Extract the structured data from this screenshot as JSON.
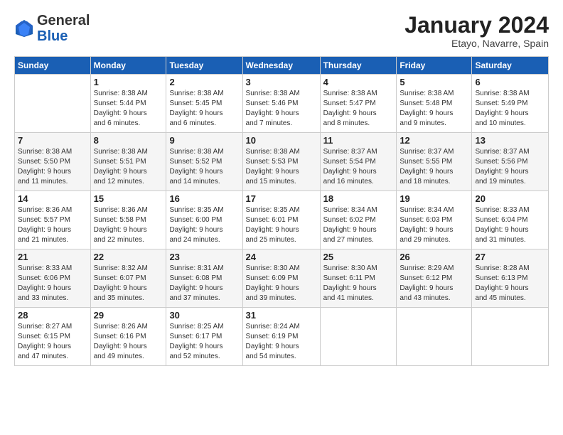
{
  "header": {
    "logo": {
      "general": "General",
      "blue": "Blue"
    },
    "title": "January 2024",
    "location": "Etayo, Navarre, Spain"
  },
  "columns": [
    "Sunday",
    "Monday",
    "Tuesday",
    "Wednesday",
    "Thursday",
    "Friday",
    "Saturday"
  ],
  "weeks": [
    [
      {
        "day": "",
        "detail": ""
      },
      {
        "day": "1",
        "detail": "Sunrise: 8:38 AM\nSunset: 5:44 PM\nDaylight: 9 hours\nand 6 minutes."
      },
      {
        "day": "2",
        "detail": "Sunrise: 8:38 AM\nSunset: 5:45 PM\nDaylight: 9 hours\nand 6 minutes."
      },
      {
        "day": "3",
        "detail": "Sunrise: 8:38 AM\nSunset: 5:46 PM\nDaylight: 9 hours\nand 7 minutes."
      },
      {
        "day": "4",
        "detail": "Sunrise: 8:38 AM\nSunset: 5:47 PM\nDaylight: 9 hours\nand 8 minutes."
      },
      {
        "day": "5",
        "detail": "Sunrise: 8:38 AM\nSunset: 5:48 PM\nDaylight: 9 hours\nand 9 minutes."
      },
      {
        "day": "6",
        "detail": "Sunrise: 8:38 AM\nSunset: 5:49 PM\nDaylight: 9 hours\nand 10 minutes."
      }
    ],
    [
      {
        "day": "7",
        "detail": "Sunrise: 8:38 AM\nSunset: 5:50 PM\nDaylight: 9 hours\nand 11 minutes."
      },
      {
        "day": "8",
        "detail": "Sunrise: 8:38 AM\nSunset: 5:51 PM\nDaylight: 9 hours\nand 12 minutes."
      },
      {
        "day": "9",
        "detail": "Sunrise: 8:38 AM\nSunset: 5:52 PM\nDaylight: 9 hours\nand 14 minutes."
      },
      {
        "day": "10",
        "detail": "Sunrise: 8:38 AM\nSunset: 5:53 PM\nDaylight: 9 hours\nand 15 minutes."
      },
      {
        "day": "11",
        "detail": "Sunrise: 8:37 AM\nSunset: 5:54 PM\nDaylight: 9 hours\nand 16 minutes."
      },
      {
        "day": "12",
        "detail": "Sunrise: 8:37 AM\nSunset: 5:55 PM\nDaylight: 9 hours\nand 18 minutes."
      },
      {
        "day": "13",
        "detail": "Sunrise: 8:37 AM\nSunset: 5:56 PM\nDaylight: 9 hours\nand 19 minutes."
      }
    ],
    [
      {
        "day": "14",
        "detail": "Sunrise: 8:36 AM\nSunset: 5:57 PM\nDaylight: 9 hours\nand 21 minutes."
      },
      {
        "day": "15",
        "detail": "Sunrise: 8:36 AM\nSunset: 5:58 PM\nDaylight: 9 hours\nand 22 minutes."
      },
      {
        "day": "16",
        "detail": "Sunrise: 8:35 AM\nSunset: 6:00 PM\nDaylight: 9 hours\nand 24 minutes."
      },
      {
        "day": "17",
        "detail": "Sunrise: 8:35 AM\nSunset: 6:01 PM\nDaylight: 9 hours\nand 25 minutes."
      },
      {
        "day": "18",
        "detail": "Sunrise: 8:34 AM\nSunset: 6:02 PM\nDaylight: 9 hours\nand 27 minutes."
      },
      {
        "day": "19",
        "detail": "Sunrise: 8:34 AM\nSunset: 6:03 PM\nDaylight: 9 hours\nand 29 minutes."
      },
      {
        "day": "20",
        "detail": "Sunrise: 8:33 AM\nSunset: 6:04 PM\nDaylight: 9 hours\nand 31 minutes."
      }
    ],
    [
      {
        "day": "21",
        "detail": "Sunrise: 8:33 AM\nSunset: 6:06 PM\nDaylight: 9 hours\nand 33 minutes."
      },
      {
        "day": "22",
        "detail": "Sunrise: 8:32 AM\nSunset: 6:07 PM\nDaylight: 9 hours\nand 35 minutes."
      },
      {
        "day": "23",
        "detail": "Sunrise: 8:31 AM\nSunset: 6:08 PM\nDaylight: 9 hours\nand 37 minutes."
      },
      {
        "day": "24",
        "detail": "Sunrise: 8:30 AM\nSunset: 6:09 PM\nDaylight: 9 hours\nand 39 minutes."
      },
      {
        "day": "25",
        "detail": "Sunrise: 8:30 AM\nSunset: 6:11 PM\nDaylight: 9 hours\nand 41 minutes."
      },
      {
        "day": "26",
        "detail": "Sunrise: 8:29 AM\nSunset: 6:12 PM\nDaylight: 9 hours\nand 43 minutes."
      },
      {
        "day": "27",
        "detail": "Sunrise: 8:28 AM\nSunset: 6:13 PM\nDaylight: 9 hours\nand 45 minutes."
      }
    ],
    [
      {
        "day": "28",
        "detail": "Sunrise: 8:27 AM\nSunset: 6:15 PM\nDaylight: 9 hours\nand 47 minutes."
      },
      {
        "day": "29",
        "detail": "Sunrise: 8:26 AM\nSunset: 6:16 PM\nDaylight: 9 hours\nand 49 minutes."
      },
      {
        "day": "30",
        "detail": "Sunrise: 8:25 AM\nSunset: 6:17 PM\nDaylight: 9 hours\nand 52 minutes."
      },
      {
        "day": "31",
        "detail": "Sunrise: 8:24 AM\nSunset: 6:19 PM\nDaylight: 9 hours\nand 54 minutes."
      },
      {
        "day": "",
        "detail": ""
      },
      {
        "day": "",
        "detail": ""
      },
      {
        "day": "",
        "detail": ""
      }
    ]
  ]
}
